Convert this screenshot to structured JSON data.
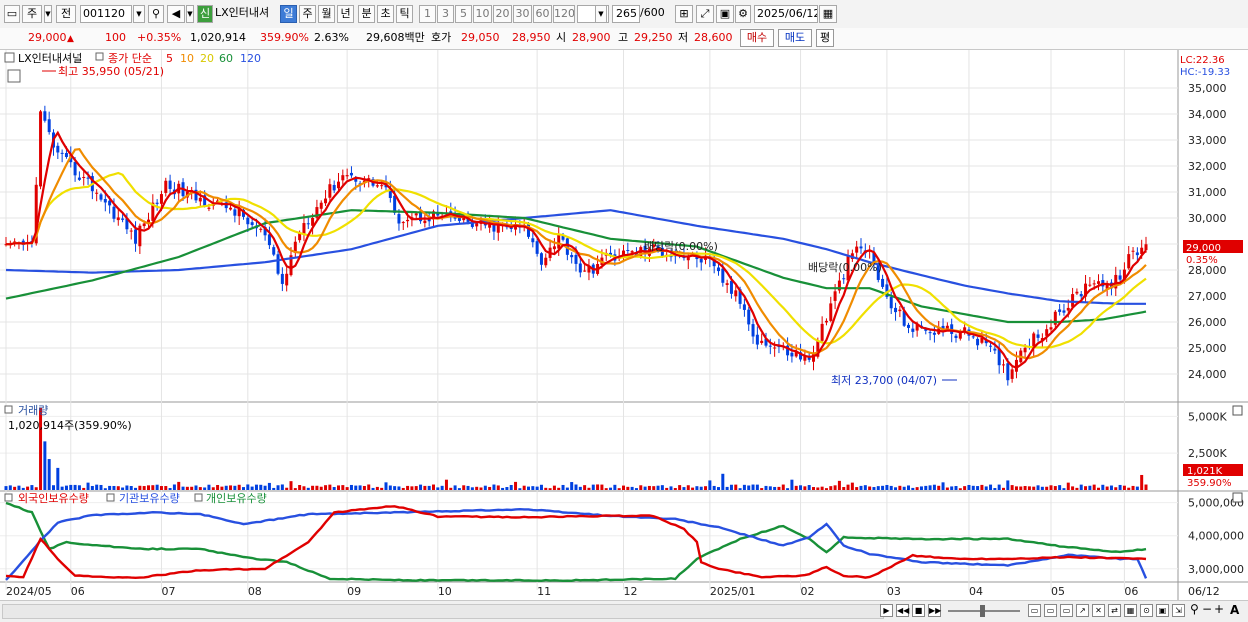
{
  "toolbar": {
    "type_label": "주",
    "prev_label": "전",
    "code_value": "001120",
    "stock_name": "LX인터내셔",
    "new_badge": "신",
    "periods": [
      "일",
      "주",
      "월",
      "년",
      "분",
      "초",
      "틱"
    ],
    "intervals": [
      "1",
      "3",
      "5",
      "10",
      "20",
      "30",
      "60",
      "120"
    ],
    "count_value": "265",
    "count_total": "/600",
    "date_value": "2025/06/12"
  },
  "info": {
    "price": "29,000",
    "change": "100",
    "change_pct": "+0.35%",
    "volume": "1,020,914",
    "volume_pct": "359.90%",
    "turnover": "2.63%",
    "amount": "29,608백만",
    "ask_label": "호가",
    "ask1": "29,050",
    "ask2": "28,950",
    "open_label": "시",
    "open": "28,900",
    "high_label": "고",
    "high": "29,250",
    "low_label": "저",
    "low": "28,600",
    "buy_label": "매수",
    "sell_label": "매도",
    "avg_label": "평"
  },
  "colors": {
    "up": "#e00000",
    "down": "#0040e0",
    "ma5": "#e00000",
    "ma10": "#f08c00",
    "ma20": "#f0e000",
    "ma60": "#189038",
    "ma120": "#2850e0",
    "foreign": "#e00000",
    "institution": "#2850e0",
    "individual": "#189038",
    "volume_down": "#0040e0"
  },
  "chart_data": [
    {
      "type": "candlestick",
      "legend": {
        "name": "LX인터내셔널",
        "ma_label": "종가 단순",
        "periods": [
          "5",
          "10",
          "20",
          "60",
          "120"
        ]
      },
      "ylim": [
        23000,
        36000
      ],
      "yticks": [
        "35,000",
        "34,000",
        "33,000",
        "32,000",
        "31,000",
        "30,000",
        "29,000",
        "28,000",
        "27,000",
        "26,000",
        "25,000",
        "24,000"
      ],
      "ytick_values": [
        35000,
        34000,
        33000,
        32000,
        31000,
        30000,
        29000,
        28000,
        27000,
        26000,
        25000,
        24000
      ],
      "months": [
        "2024/05",
        "06",
        "07",
        "08",
        "09",
        "10",
        "11",
        "12",
        "2025/01",
        "02",
        "03",
        "04",
        "05",
        "06",
        "06/12"
      ],
      "max_annotation": "최고 35,950 (05/21)",
      "min_annotation": "최저 23,700 (04/07)",
      "annotations": [
        "배당락(0.00%)",
        "배당락(0.00%)"
      ],
      "lc_label": "LC:22.36",
      "hc_label": "HC:-19.33",
      "current_price": "29,000",
      "current_change": "0.35%",
      "close_anchors": [
        [
          0,
          28800
        ],
        [
          6,
          29000
        ],
        [
          8,
          34000
        ],
        [
          12,
          32400
        ],
        [
          20,
          31200
        ],
        [
          30,
          29200
        ],
        [
          37,
          31300
        ],
        [
          45,
          30700
        ],
        [
          52,
          30400
        ],
        [
          60,
          29300
        ],
        [
          64,
          27400
        ],
        [
          68,
          29600
        ],
        [
          78,
          31700
        ],
        [
          88,
          31200
        ],
        [
          90,
          30000
        ],
        [
          100,
          30100
        ],
        [
          110,
          29700
        ],
        [
          120,
          29600
        ],
        [
          124,
          28400
        ],
        [
          128,
          29300
        ],
        [
          134,
          27800
        ],
        [
          138,
          28400
        ],
        [
          142,
          28600
        ],
        [
          150,
          28800
        ],
        [
          162,
          28400
        ],
        [
          170,
          26800
        ],
        [
          174,
          25300
        ],
        [
          182,
          24800
        ],
        [
          186,
          24500
        ],
        [
          190,
          26200
        ],
        [
          196,
          28700
        ],
        [
          200,
          28700
        ],
        [
          204,
          26800
        ],
        [
          210,
          25700
        ],
        [
          216,
          25700
        ],
        [
          224,
          25500
        ],
        [
          228,
          24900
        ],
        [
          232,
          24000
        ],
        [
          236,
          25200
        ],
        [
          240,
          25600
        ],
        [
          246,
          26700
        ],
        [
          252,
          27700
        ],
        [
          256,
          27300
        ],
        [
          260,
          28400
        ],
        [
          264,
          29000
        ]
      ],
      "ma120_anchors": [
        [
          0,
          28000
        ],
        [
          20,
          27900
        ],
        [
          40,
          28000
        ],
        [
          60,
          28300
        ],
        [
          80,
          28800
        ],
        [
          100,
          29700
        ],
        [
          120,
          30000
        ],
        [
          140,
          30300
        ],
        [
          160,
          29700
        ],
        [
          180,
          29200
        ],
        [
          190,
          28800
        ],
        [
          200,
          28300
        ],
        [
          212,
          27800
        ],
        [
          222,
          27400
        ],
        [
          232,
          27100
        ],
        [
          244,
          26800
        ],
        [
          258,
          26700
        ],
        [
          264,
          26700
        ]
      ],
      "ma60_anchors": [
        [
          0,
          26900
        ],
        [
          20,
          27600
        ],
        [
          40,
          28500
        ],
        [
          60,
          29800
        ],
        [
          80,
          30300
        ],
        [
          100,
          30200
        ],
        [
          120,
          30000
        ],
        [
          140,
          29200
        ],
        [
          160,
          28900
        ],
        [
          180,
          27700
        ],
        [
          190,
          27300
        ],
        [
          200,
          27300
        ],
        [
          212,
          26600
        ],
        [
          222,
          26300
        ],
        [
          232,
          26000
        ],
        [
          244,
          26000
        ],
        [
          254,
          26100
        ],
        [
          264,
          26400
        ]
      ]
    },
    {
      "type": "bar",
      "title": "거래량",
      "value_label": "1,020,914주(359.90%)",
      "yticks": [
        "5,000K",
        "2,500K"
      ],
      "ytick_values": [
        5000,
        2500
      ],
      "ylim": [
        0,
        5700
      ],
      "current_label": "1,021K",
      "current_pct": "359.90%",
      "spikes": [
        [
          8,
          5600
        ],
        [
          9,
          3300
        ],
        [
          10,
          2100
        ],
        [
          12,
          1500
        ],
        [
          19,
          500
        ],
        [
          40,
          550
        ],
        [
          61,
          480
        ],
        [
          66,
          600
        ],
        [
          88,
          520
        ],
        [
          102,
          700
        ],
        [
          118,
          550
        ],
        [
          131,
          540
        ],
        [
          163,
          650
        ],
        [
          166,
          1100
        ],
        [
          182,
          700
        ],
        [
          193,
          620
        ],
        [
          196,
          500
        ],
        [
          217,
          520
        ],
        [
          232,
          650
        ],
        [
          246,
          500
        ],
        [
          263,
          1020
        ]
      ]
    },
    {
      "type": "line",
      "series_labels": [
        "외국인보유수량",
        "기관보유수량",
        "개인보유수량"
      ],
      "yticks": [
        "5,000,000",
        "4,000,000",
        "3,000,000"
      ],
      "ytick_values": [
        5000000,
        4000000,
        3000000
      ],
      "ylim": [
        2600000,
        5200000
      ],
      "foreign_anchors": [
        [
          0,
          2780000
        ],
        [
          4,
          2760000
        ],
        [
          8,
          3900000
        ],
        [
          12,
          3300000
        ],
        [
          16,
          2790000
        ],
        [
          30,
          2720000
        ],
        [
          45,
          2960000
        ],
        [
          60,
          3000000
        ],
        [
          70,
          3800000
        ],
        [
          76,
          4700000
        ],
        [
          90,
          4900000
        ],
        [
          100,
          4580000
        ],
        [
          120,
          4560000
        ],
        [
          140,
          4600000
        ],
        [
          150,
          4600000
        ],
        [
          157,
          4200000
        ],
        [
          160,
          3800000
        ],
        [
          161,
          3200000
        ],
        [
          165,
          3000000
        ],
        [
          175,
          2750000
        ],
        [
          185,
          2800000
        ],
        [
          190,
          3050000
        ],
        [
          194,
          2780000
        ],
        [
          200,
          2740000
        ],
        [
          210,
          3400000
        ],
        [
          220,
          3300000
        ],
        [
          232,
          3300000
        ],
        [
          246,
          3350000
        ],
        [
          264,
          3300000
        ]
      ],
      "institution_anchors": [
        [
          0,
          2650000
        ],
        [
          8,
          3850000
        ],
        [
          12,
          4400000
        ],
        [
          20,
          4620000
        ],
        [
          35,
          4700000
        ],
        [
          45,
          4650000
        ],
        [
          55,
          4350000
        ],
        [
          70,
          4650000
        ],
        [
          90,
          4700000
        ],
        [
          120,
          4800000
        ],
        [
          140,
          4600000
        ],
        [
          155,
          4500000
        ],
        [
          165,
          4250000
        ],
        [
          180,
          3700000
        ],
        [
          186,
          3950000
        ],
        [
          190,
          4350000
        ],
        [
          194,
          3700000
        ],
        [
          200,
          3450000
        ],
        [
          212,
          3200000
        ],
        [
          222,
          3150000
        ],
        [
          232,
          3100000
        ],
        [
          246,
          3420000
        ],
        [
          258,
          3300000
        ],
        [
          262,
          3300000
        ],
        [
          264,
          2700000
        ]
      ],
      "individual_anchors": [
        [
          0,
          5000000
        ],
        [
          6,
          4700000
        ],
        [
          10,
          3600000
        ],
        [
          14,
          3800000
        ],
        [
          30,
          3600000
        ],
        [
          45,
          3600000
        ],
        [
          55,
          3350000
        ],
        [
          65,
          3200000
        ],
        [
          75,
          2700000
        ],
        [
          95,
          2650000
        ],
        [
          130,
          2650000
        ],
        [
          155,
          2700000
        ],
        [
          160,
          3300000
        ],
        [
          170,
          3900000
        ],
        [
          180,
          4300000
        ],
        [
          186,
          3900000
        ],
        [
          190,
          3500000
        ],
        [
          194,
          3950000
        ],
        [
          210,
          3900000
        ],
        [
          232,
          3900000
        ],
        [
          246,
          3650000
        ],
        [
          258,
          3500000
        ],
        [
          264,
          3600000
        ]
      ]
    }
  ],
  "bottom": {
    "zoom_label": "A"
  }
}
